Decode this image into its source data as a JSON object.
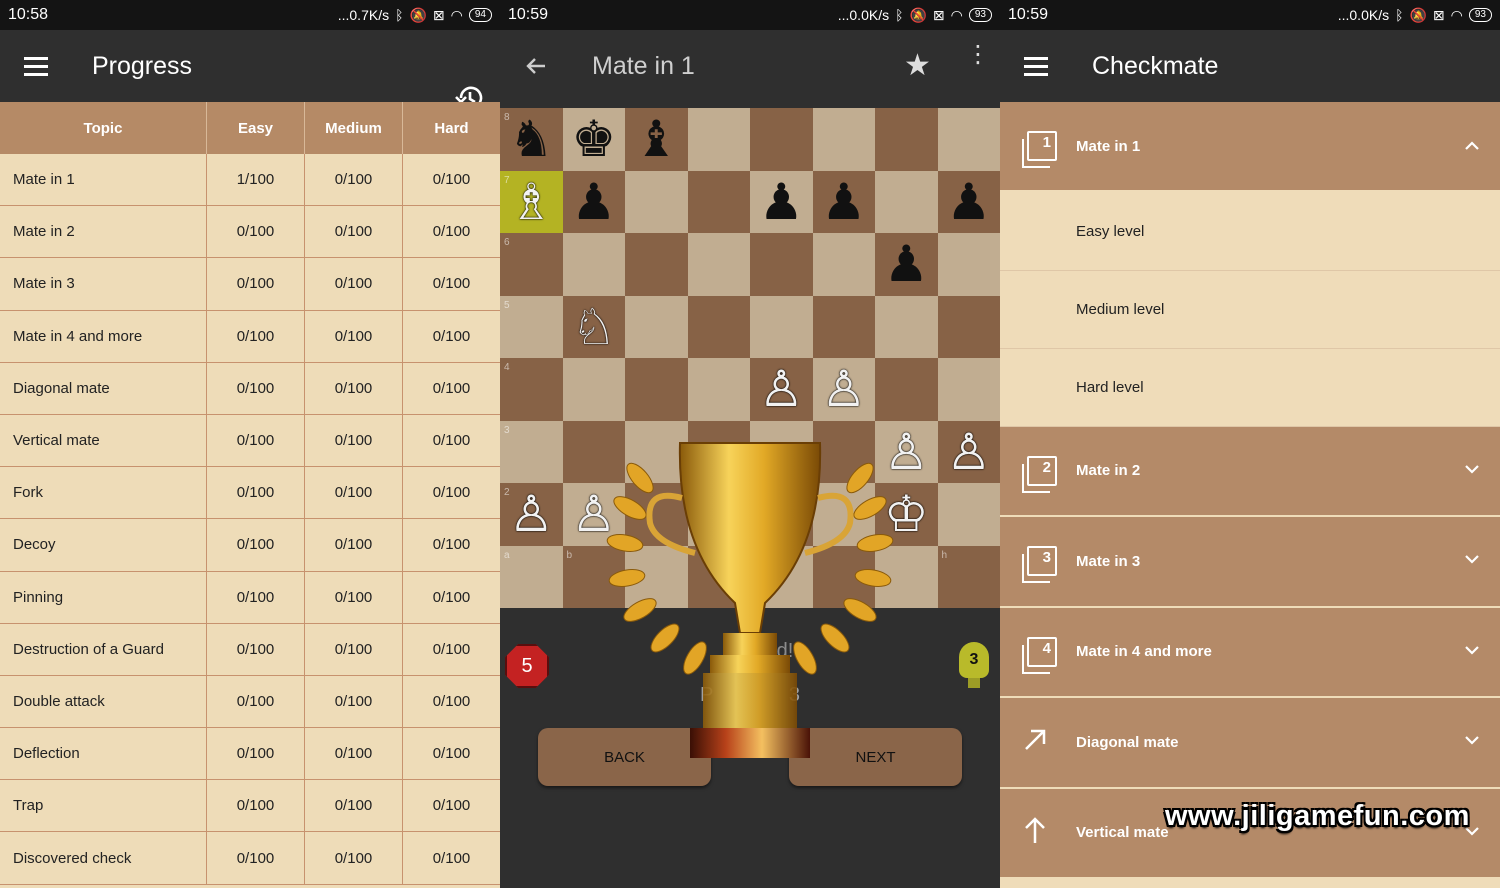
{
  "screens": [
    {
      "status": {
        "time": "10:58",
        "speed": "...0.7K/s",
        "battery": "94"
      },
      "title": "Progress"
    },
    {
      "status": {
        "time": "10:59",
        "speed": "...0.0K/s",
        "battery": "93"
      },
      "title": "Mate in 1"
    },
    {
      "status": {
        "time": "10:59",
        "speed": "...0.0K/s",
        "battery": "93"
      },
      "title": "Checkmate"
    }
  ],
  "progress": {
    "headers": [
      "Topic",
      "Easy",
      "Medium",
      "Hard"
    ],
    "rows": [
      [
        "Mate in 1",
        "1/100",
        "0/100",
        "0/100"
      ],
      [
        "Mate in 2",
        "0/100",
        "0/100",
        "0/100"
      ],
      [
        "Mate in 3",
        "0/100",
        "0/100",
        "0/100"
      ],
      [
        "Mate in 4 and more",
        "0/100",
        "0/100",
        "0/100"
      ],
      [
        "Diagonal mate",
        "0/100",
        "0/100",
        "0/100"
      ],
      [
        "Vertical mate",
        "0/100",
        "0/100",
        "0/100"
      ],
      [
        "Fork",
        "0/100",
        "0/100",
        "0/100"
      ],
      [
        "Decoy",
        "0/100",
        "0/100",
        "0/100"
      ],
      [
        "Pinning",
        "0/100",
        "0/100",
        "0/100"
      ],
      [
        "Destruction of a Guard",
        "0/100",
        "0/100",
        "0/100"
      ],
      [
        "Double attack",
        "0/100",
        "0/100",
        "0/100"
      ],
      [
        "Deflection",
        "0/100",
        "0/100",
        "0/100"
      ],
      [
        "Trap",
        "0/100",
        "0/100",
        "0/100"
      ],
      [
        "Discovered check",
        "0/100",
        "0/100",
        "0/100"
      ]
    ]
  },
  "puzzle": {
    "rank_labels": [
      "8",
      "7",
      "6",
      "5",
      "4",
      "3",
      "2"
    ],
    "file_labels": [
      "a",
      "b",
      "h"
    ],
    "mistakes_badge": "5",
    "hints_badge": "3",
    "solved_text": "Solved!",
    "puzzle_prefix": "P",
    "puzzle_number": "3",
    "back_label": "BACK",
    "next_label": "NEXT",
    "pieces": {
      "a8": "♞",
      "b8": "♚",
      "c8": "♝",
      "a7": "♗",
      "b7": "♟",
      "e7": "♟",
      "f7": "♟",
      "h7": "♟",
      "g6": "♟",
      "b5": "♘",
      "e4": "♙",
      "f4": "♙",
      "g3": "♙",
      "h3": "♙",
      "a2": "♙",
      "b2": "♙",
      "g2": "♔"
    },
    "white": [
      "a7",
      "b5",
      "e4",
      "f4",
      "g3",
      "h3",
      "a2",
      "b2",
      "g2"
    ],
    "highlight": "a7"
  },
  "checkmate": {
    "sections": [
      {
        "label": "Mate in 1",
        "icon": "1",
        "expanded": true
      },
      {
        "label": "Mate in 2",
        "icon": "2"
      },
      {
        "label": "Mate in 3",
        "icon": "3"
      },
      {
        "label": "Mate in 4 and more",
        "icon": "4"
      },
      {
        "label": "Diagonal mate",
        "icon": "diagonal-arrow"
      },
      {
        "label": "Vertical mate",
        "icon": "up-arrow"
      }
    ],
    "sub_items": [
      "Easy level",
      "Medium level",
      "Hard level"
    ]
  },
  "watermark": "www.jiligamefun.com",
  "colors": {
    "table_header": "#b58a66",
    "row_bg": "#eedcb8",
    "appbar": "#2f2f2f",
    "highlight": "#b4b323",
    "badge_red": "#c42222"
  }
}
